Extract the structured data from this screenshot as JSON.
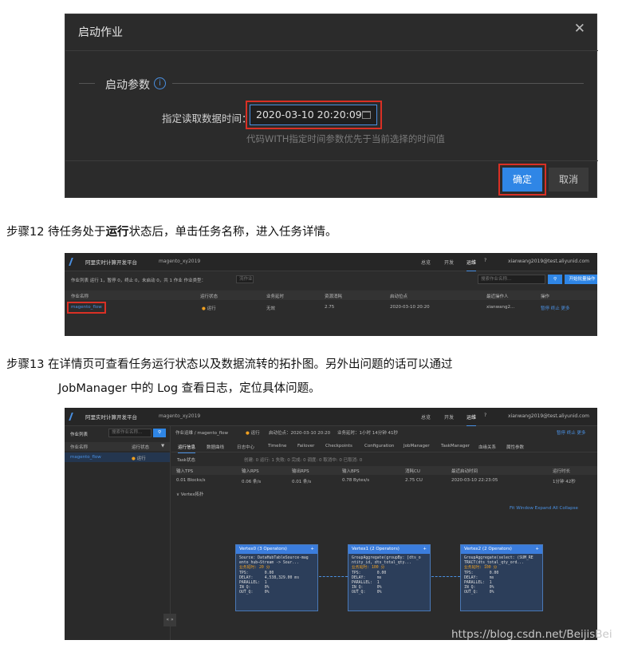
{
  "dialog": {
    "title": "启动作业",
    "close": "✕",
    "section": "启动参数",
    "info": "i",
    "label": "指定读取数据时间：",
    "value": "2020-03-10 20:20:09",
    "hint": "代码WITH指定时间参数优先于当前选择的时间值",
    "ok": "确定",
    "cancel": "取消"
  },
  "step12": {
    "prefix": "步骤12 待任务处于",
    "bold": "运行",
    "suffix": "状态后，单击任务名称，进入任务详情。"
  },
  "step13": {
    "line1": "步骤13 在详情页可查看任务运行状态以及数据流转的拓扑图。另外出问题的话可以通过",
    "line2": "JobManager 中的 Log 查看日志，定位具体问题。"
  },
  "joblist": {
    "app": "阿里实时计算开发平台",
    "project": "magento_xy2019",
    "nav": [
      "总览",
      "开发",
      "运维"
    ],
    "user": "xianwang2019@test.aliyunid.com",
    "filter": "作业列表  运行 1，暂停 0，终止 0，未启动 0，共 1 作业   作业类型：",
    "filter_select": "流作业",
    "search_placeholder": "搜索作业名称...",
    "create": "开始批量操作",
    "columns": [
      "作业名称",
      "运行状态",
      "业务延时",
      "资源消耗",
      "启动位点",
      "最近操作人",
      "操作"
    ],
    "row": {
      "name": "magento_flow",
      "status": "运行",
      "delay": "无效",
      "cost": "2.75",
      "start": "2020-03-10 20:20",
      "operator": "xianwang2...",
      "actions": "暂停  终止  更多"
    }
  },
  "detail": {
    "app": "阿里实时计算开发平台",
    "project": "magento_xy2019",
    "breadcrumb": "作业运维  /  magento_flow",
    "status": "运行",
    "start_label": "启动位点：2020-03-10 20:20",
    "biz_delay": "业务延时：1小时 14分钟 41秒",
    "actions": "暂停   终止   更多",
    "side_title": "作业列表",
    "side_search": "搜索作业名称...",
    "side_cols": [
      "作业名称",
      "运行状态"
    ],
    "side_row": {
      "name": "magento_flow",
      "status": "运行"
    },
    "tabs": [
      "运行信息",
      "数据曲线",
      "日志中心",
      "Timeline",
      "Failover",
      "Checkpoints",
      "Configuration",
      "JobManager",
      "TaskManager",
      "血缘关系",
      "属性参数"
    ],
    "task_status": "Task状态",
    "task_counts": "创建: 0  运行: 1  失败: 0  完成: 0  调度: 0  取消中: 0  已取消: 0",
    "metrics_head": [
      "输入TPS",
      "输入RPS",
      "输出RPS",
      "输入BPS",
      "消耗CU",
      "最近启动时间",
      "运行时长"
    ],
    "metrics_vals": [
      "0.01 Blocks/s",
      "0.06 条/s",
      "0.01 条/s",
      "0.78 Bytes/s",
      "2.75 CU",
      "2020-03-10 22:23:05",
      "1分钟 42秒"
    ],
    "topology": "Vertex拓扑",
    "topo_ctrls": "Fit Window   Expand All   Collapse",
    "nodes": [
      {
        "title": "Vertex0 (3 Operators)",
        "src": "Source: DataHubTableSource-mag\nento_hub→Stream -> Sour...",
        "lag": "业务延时: 20 分",
        "stats": "TPS:       0.00\nDELAY:     4,538,329.00 ms\nPARALLEL:  1\nIN_Q:      0%\nOUT_Q:     0%"
      },
      {
        "title": "Vertex1 (2 Operators)",
        "src": "GroupAggregate(groupBy: [dts_o\nntity_id, dts_total_qty...",
        "lag": "业务延时: 100 分",
        "stats": "TPS:       0.00\nDELAY:     ms\nPARALLEL:  1\nIN_Q:      0%\nOUT_Q:     0%"
      },
      {
        "title": "Vertex2 (2 Operators)",
        "src": "GroupAggregate(select: (SUM_RE\nTRACT(dts_total_qty_ord...",
        "lag": "业务延时: 100 分",
        "stats": "TPS:       0.00\nDELAY:     ms\nPARALLEL:  1\nIN_Q:      0%\nOUT_Q:     0%"
      }
    ]
  },
  "watermark": "https://blog.csdn.net/BeijisBei"
}
